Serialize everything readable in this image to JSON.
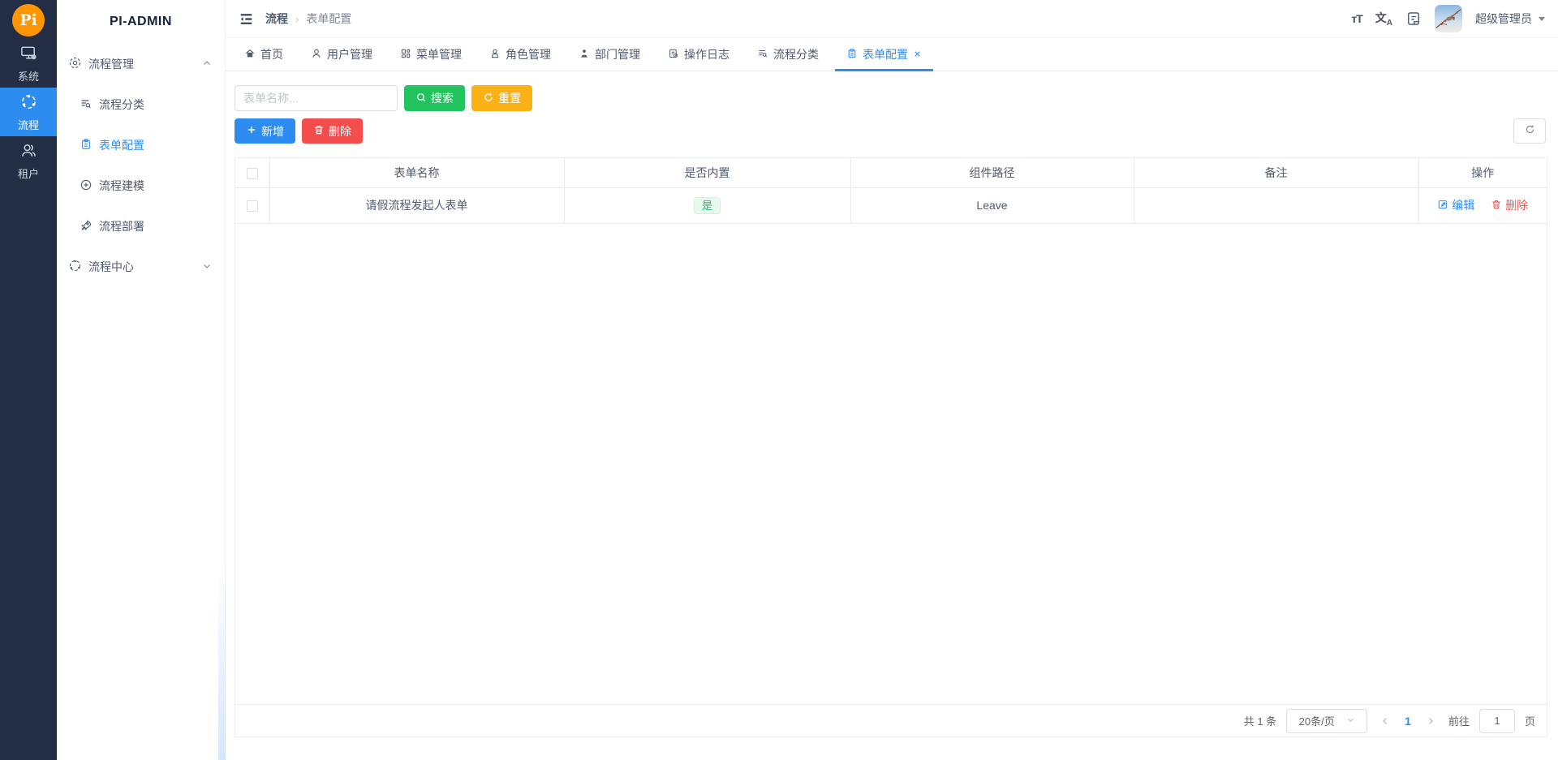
{
  "app": {
    "title": "PI-ADMIN"
  },
  "colors": {
    "rail_bg": "#232e44",
    "accent_blue": "#2d8cf0",
    "success_green": "#22c35e",
    "warning_amber": "#f9b115",
    "danger_red": "#f34d4d",
    "badge_bg": "#e7f9ed",
    "badge_text": "#1fbb68",
    "logo_orange": "#ff9500"
  },
  "rail": {
    "logo_text": "Pi",
    "items": [
      {
        "label": "系统"
      },
      {
        "label": "流程"
      },
      {
        "label": "租户"
      }
    ]
  },
  "sidebar": {
    "items": [
      {
        "label": "流程管理",
        "children": [
          {
            "label": "流程分类"
          },
          {
            "label": "表单配置"
          },
          {
            "label": "流程建模"
          },
          {
            "label": "流程部署"
          }
        ]
      },
      {
        "label": "流程中心",
        "children": []
      }
    ]
  },
  "header": {
    "breadcrumb": [
      "流程",
      "表单配置"
    ],
    "user": {
      "name": "超级管理员"
    }
  },
  "tabs": {
    "items": [
      {
        "label": "首页"
      },
      {
        "label": "用户管理"
      },
      {
        "label": "菜单管理"
      },
      {
        "label": "角色管理"
      },
      {
        "label": "部门管理"
      },
      {
        "label": "操作日志"
      },
      {
        "label": "流程分类"
      },
      {
        "label": "表单配置"
      }
    ]
  },
  "toolbar": {
    "search_placeholder": "表单名称...",
    "search_label": "搜索",
    "reset_label": "重置",
    "add_label": "新增",
    "delete_label": "删除"
  },
  "table": {
    "columns": [
      "表单名称",
      "是否内置",
      "组件路径",
      "备注",
      "操作"
    ],
    "rows": [
      {
        "name": "请假流程发起人表单",
        "builtin": "是",
        "component_path": "Leave",
        "remark": "",
        "actions": {
          "edit": "编辑",
          "delete": "删除"
        }
      }
    ]
  },
  "pagination": {
    "total_text": "共 1 条",
    "page_size": "20条/页",
    "current_page": "1",
    "goto_label": "前往",
    "goto_value": "1",
    "unit_label": "页"
  }
}
